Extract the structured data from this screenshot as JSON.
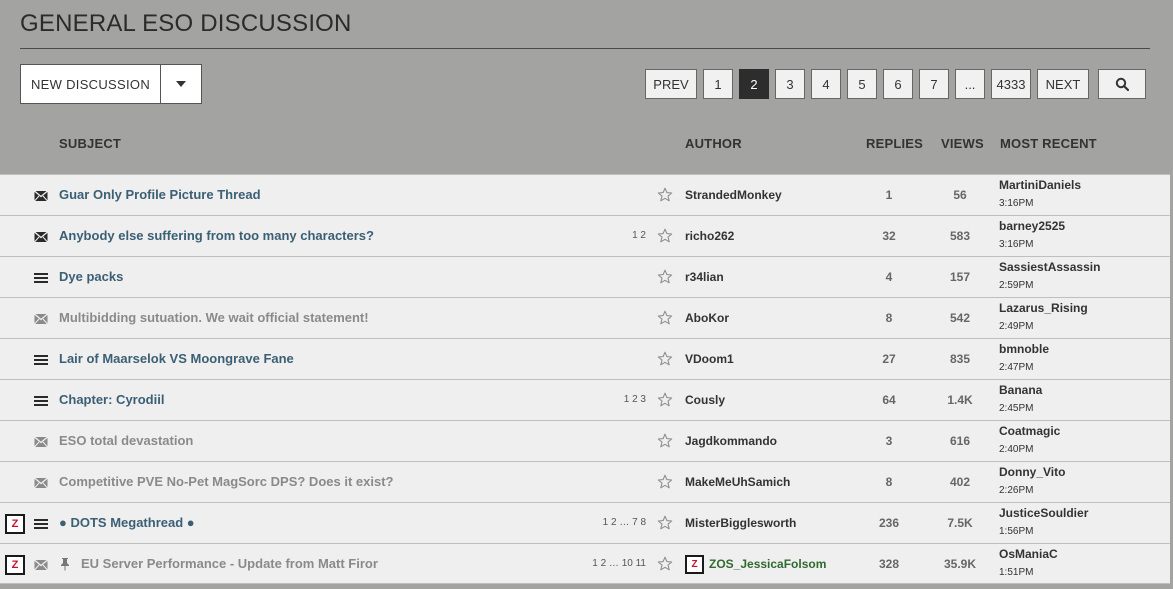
{
  "page": {
    "title": "GENERAL ESO DISCUSSION"
  },
  "toolbar": {
    "new_discussion_label": "NEW DISCUSSION"
  },
  "pager": {
    "prev": "PREV",
    "pages": [
      "1",
      "2",
      "3",
      "4",
      "5",
      "6",
      "7",
      "...",
      "4333"
    ],
    "active_page": "2",
    "next": "NEXT"
  },
  "columns": {
    "subject": "SUBJECT",
    "author": "AUTHOR",
    "replies": "REPLIES",
    "views": "VIEWS",
    "most_recent": "MOST RECENT"
  },
  "threads": [
    {
      "subject": "Guar Only Profile Picture Thread",
      "type": "envelope",
      "read": false,
      "pages": "",
      "author": "StrandedMonkey",
      "replies": "1",
      "views": "56",
      "recent_user": "MartiniDaniels",
      "recent_time": "3:16PM",
      "zos_thread": false,
      "zos_author": false,
      "pinned": false
    },
    {
      "subject": "Anybody else suffering from too many characters?",
      "type": "envelope",
      "read": false,
      "pages": "1 2",
      "author": "richo262",
      "replies": "32",
      "views": "583",
      "recent_user": "barney2525",
      "recent_time": "3:16PM",
      "zos_thread": false,
      "zos_author": false,
      "pinned": false
    },
    {
      "subject": "Dye packs",
      "type": "list",
      "read": false,
      "pages": "",
      "author": "r34lian",
      "replies": "4",
      "views": "157",
      "recent_user": "SassiestAssassin",
      "recent_time": "2:59PM",
      "zos_thread": false,
      "zos_author": false,
      "pinned": false
    },
    {
      "subject": "Multibidding sutuation. We wait official statement!",
      "type": "envelope",
      "read": true,
      "pages": "",
      "author": "AboKor",
      "replies": "8",
      "views": "542",
      "recent_user": "Lazarus_Rising",
      "recent_time": "2:49PM",
      "zos_thread": false,
      "zos_author": false,
      "pinned": false
    },
    {
      "subject": "Lair of Maarselok VS Moongrave Fane",
      "type": "list",
      "read": false,
      "pages": "",
      "author": "VDoom1",
      "replies": "27",
      "views": "835",
      "recent_user": "bmnoble",
      "recent_time": "2:47PM",
      "zos_thread": false,
      "zos_author": false,
      "pinned": false
    },
    {
      "subject": "Chapter: Cyrodiil",
      "type": "list",
      "read": false,
      "pages": "1 2 3",
      "author": "Cously",
      "replies": "64",
      "views": "1.4K",
      "recent_user": "Banana",
      "recent_time": "2:45PM",
      "zos_thread": false,
      "zos_author": false,
      "pinned": false
    },
    {
      "subject": "ESO total devastation",
      "type": "envelope",
      "read": true,
      "pages": "",
      "author": "Jagdkommando",
      "replies": "3",
      "views": "616",
      "recent_user": "Coatmagic",
      "recent_time": "2:40PM",
      "zos_thread": false,
      "zos_author": false,
      "pinned": false
    },
    {
      "subject": "Competitive PVE No-Pet MagSorc DPS? Does it exist?",
      "type": "envelope",
      "read": true,
      "pages": "",
      "author": "MakeMeUhSamich",
      "replies": "8",
      "views": "402",
      "recent_user": "Donny_Vito",
      "recent_time": "2:26PM",
      "zos_thread": false,
      "zos_author": false,
      "pinned": false
    },
    {
      "subject": "● DOTS Megathread ●",
      "type": "list",
      "read": false,
      "pages": "1 2 … 7 8",
      "author": "MisterBigglesworth",
      "replies": "236",
      "views": "7.5K",
      "recent_user": "JusticeSouldier",
      "recent_time": "1:56PM",
      "zos_thread": true,
      "zos_author": false,
      "pinned": false
    },
    {
      "subject": "EU Server Performance - Update from Matt Firor",
      "type": "envelope",
      "read": true,
      "pages": "1 2 … 10 11",
      "author": "ZOS_JessicaFolsom",
      "replies": "328",
      "views": "35.9K",
      "recent_user": "OsManiaC",
      "recent_time": "1:51PM",
      "zos_thread": true,
      "zos_author": true,
      "pinned": true
    }
  ],
  "icons": {
    "search": "search-icon",
    "caret": "chevron-down-icon",
    "star": "star-icon",
    "envelope": "envelope-icon",
    "list": "list-icon",
    "pin": "pin-icon",
    "zos_badge": "Z"
  },
  "colors": {
    "header_bg": "#a3a3a1",
    "row_bg": "#efefef",
    "link": "#3b5f74",
    "read_link": "#8a8a8a",
    "zos_red": "#c8102e",
    "zos_author": "#2f6a2f",
    "active_page": "#2d2d2d"
  }
}
